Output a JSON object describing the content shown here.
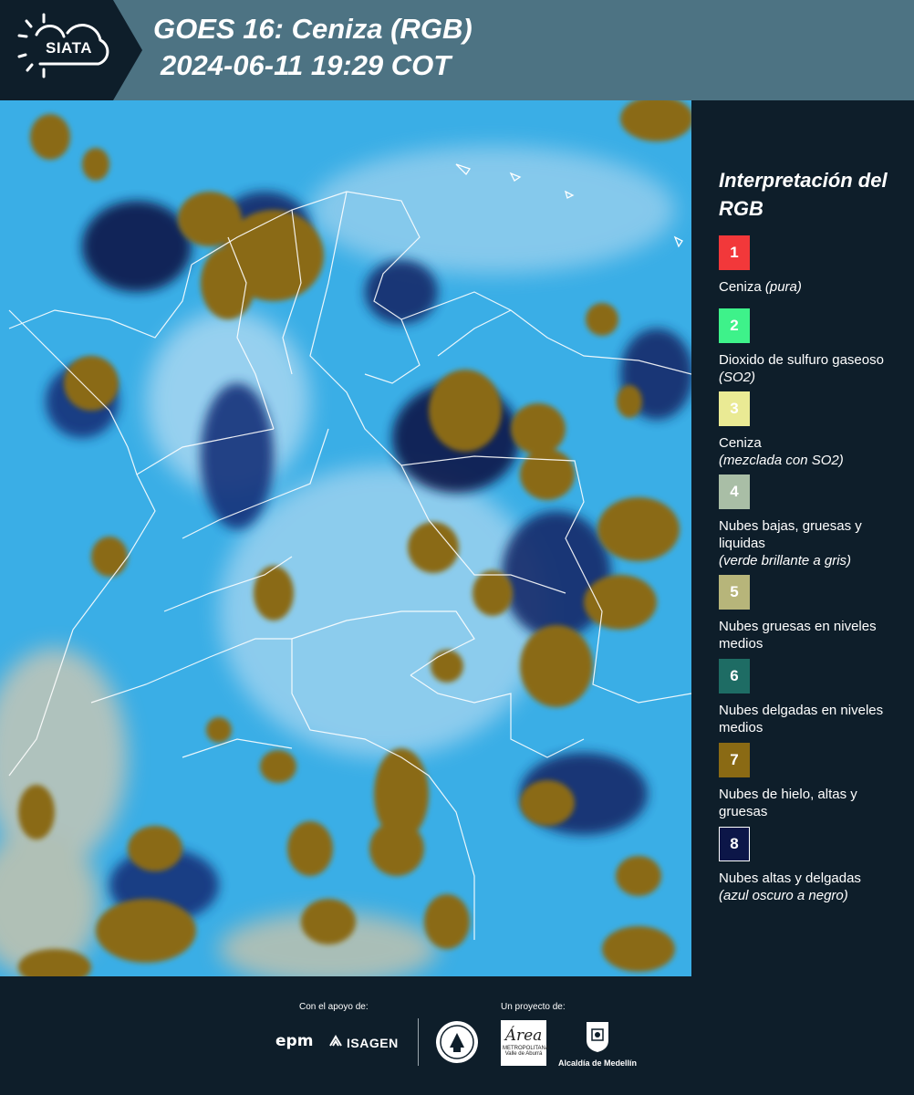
{
  "header": {
    "logo_text": "SIATA",
    "title_line_1": "GOES 16: Ceniza (RGB)",
    "title_line_2": "2024-06-11 19:29 COT",
    "background_color": "#4d7383",
    "logo_background_color": "#0e1e2a"
  },
  "legend": {
    "title": "Interpretación del RGB",
    "items": [
      {
        "number": "1",
        "label": "Ceniza",
        "note": "(pura)",
        "color": "#f2383a",
        "text_color": "#ffffff"
      },
      {
        "number": "2",
        "label": "Dioxido de sulfuro gaseoso",
        "note": "(SO2)",
        "color": "#3ef28a",
        "text_color": "#ffffff"
      },
      {
        "number": "3",
        "label": "Ceniza",
        "note": "(mezclada con SO2)",
        "color": "#eaea94",
        "text_color": "#ffffff"
      },
      {
        "number": "4",
        "label": "Nubes bajas, gruesas y liquidas",
        "note": "(verde brillante a gris)",
        "color": "#a9bea6",
        "text_color": "#ffffff"
      },
      {
        "number": "5",
        "label": "Nubes gruesas en niveles medios",
        "note": "",
        "color": "#b7b57a",
        "text_color": "#ffffff"
      },
      {
        "number": "6",
        "label": "Nubes delgadas en niveles medios",
        "note": "",
        "color": "#1e6c64",
        "text_color": "#ffffff"
      },
      {
        "number": "7",
        "label": "Nubes de hielo, altas y gruesas",
        "note": "",
        "color": "#8a6a14",
        "text_color": "#ffffff"
      },
      {
        "number": "8",
        "label": "Nubes altas y delgadas",
        "note": "(azul oscuro a negro)",
        "color": "#0c1648",
        "text_color": "#ffffff"
      }
    ]
  },
  "footer": {
    "support_caption": "Con el apoyo de:",
    "project_caption": "Un proyecto de:",
    "sponsor_1": "epm",
    "sponsor_2": "ISAGEN",
    "area_logo_text": "METROPOLITANA Valle de Aburrá",
    "area_logo_script": "Área",
    "alcaldia_text": "Alcaldía de Medellín"
  },
  "map": {
    "ocean_color": "#3aaee6",
    "ice_cloud_color": "#8a6a14",
    "thin_cloud_color": "#0c1648",
    "border_color": "#ffffff"
  },
  "icons": {
    "logo": "sun-cloud-icon",
    "isagen_mark": "isagen-arrows-icon",
    "seal": "seal-icon",
    "alcaldia": "shield-icon"
  }
}
